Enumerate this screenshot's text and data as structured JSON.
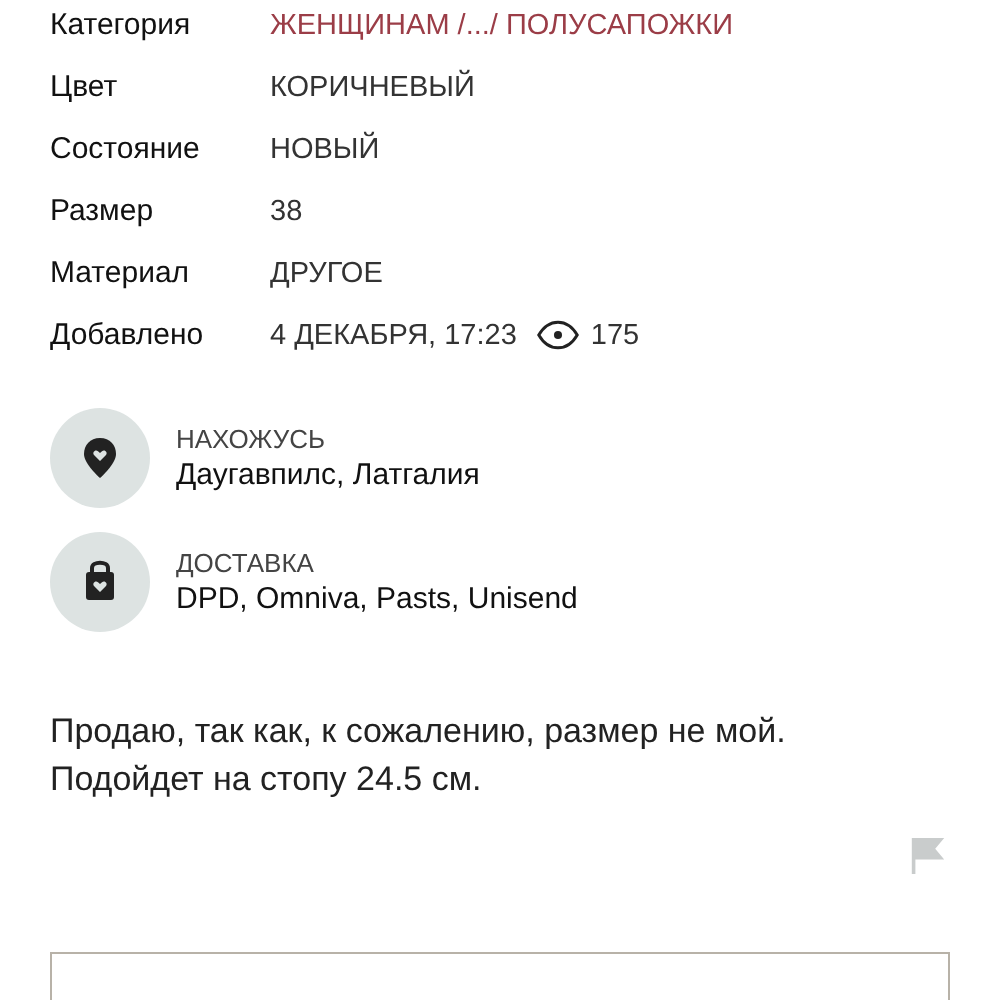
{
  "details": [
    {
      "label": "Категория",
      "value": "ЖЕНЩИНАМ /.../ ПОЛУСАПОЖКИ",
      "kind": "link"
    },
    {
      "label": "Цвет",
      "value": "КОРИЧНЕВЫЙ",
      "kind": "text"
    },
    {
      "label": "Состояние",
      "value": "НОВЫЙ",
      "kind": "text"
    },
    {
      "label": "Размер",
      "value": "38",
      "kind": "text"
    },
    {
      "label": "Материал",
      "value": "ДРУГОЕ",
      "kind": "text"
    },
    {
      "label": "Добавлено",
      "value": "4 ДЕКАБРЯ, 17:23",
      "kind": "views",
      "views": "175"
    }
  ],
  "info": [
    {
      "kind": "location",
      "title": "НАХОЖУСЬ",
      "value": "Даугавпилс, Латгалия"
    },
    {
      "kind": "delivery",
      "title": "ДОСТАВКА",
      "value": "DPD, Omniva, Pasts, Unisend"
    }
  ],
  "description": [
    "Продаю, так как, к сожалению, размер не мой.",
    "Подойдет на стопу 24.5 см."
  ]
}
